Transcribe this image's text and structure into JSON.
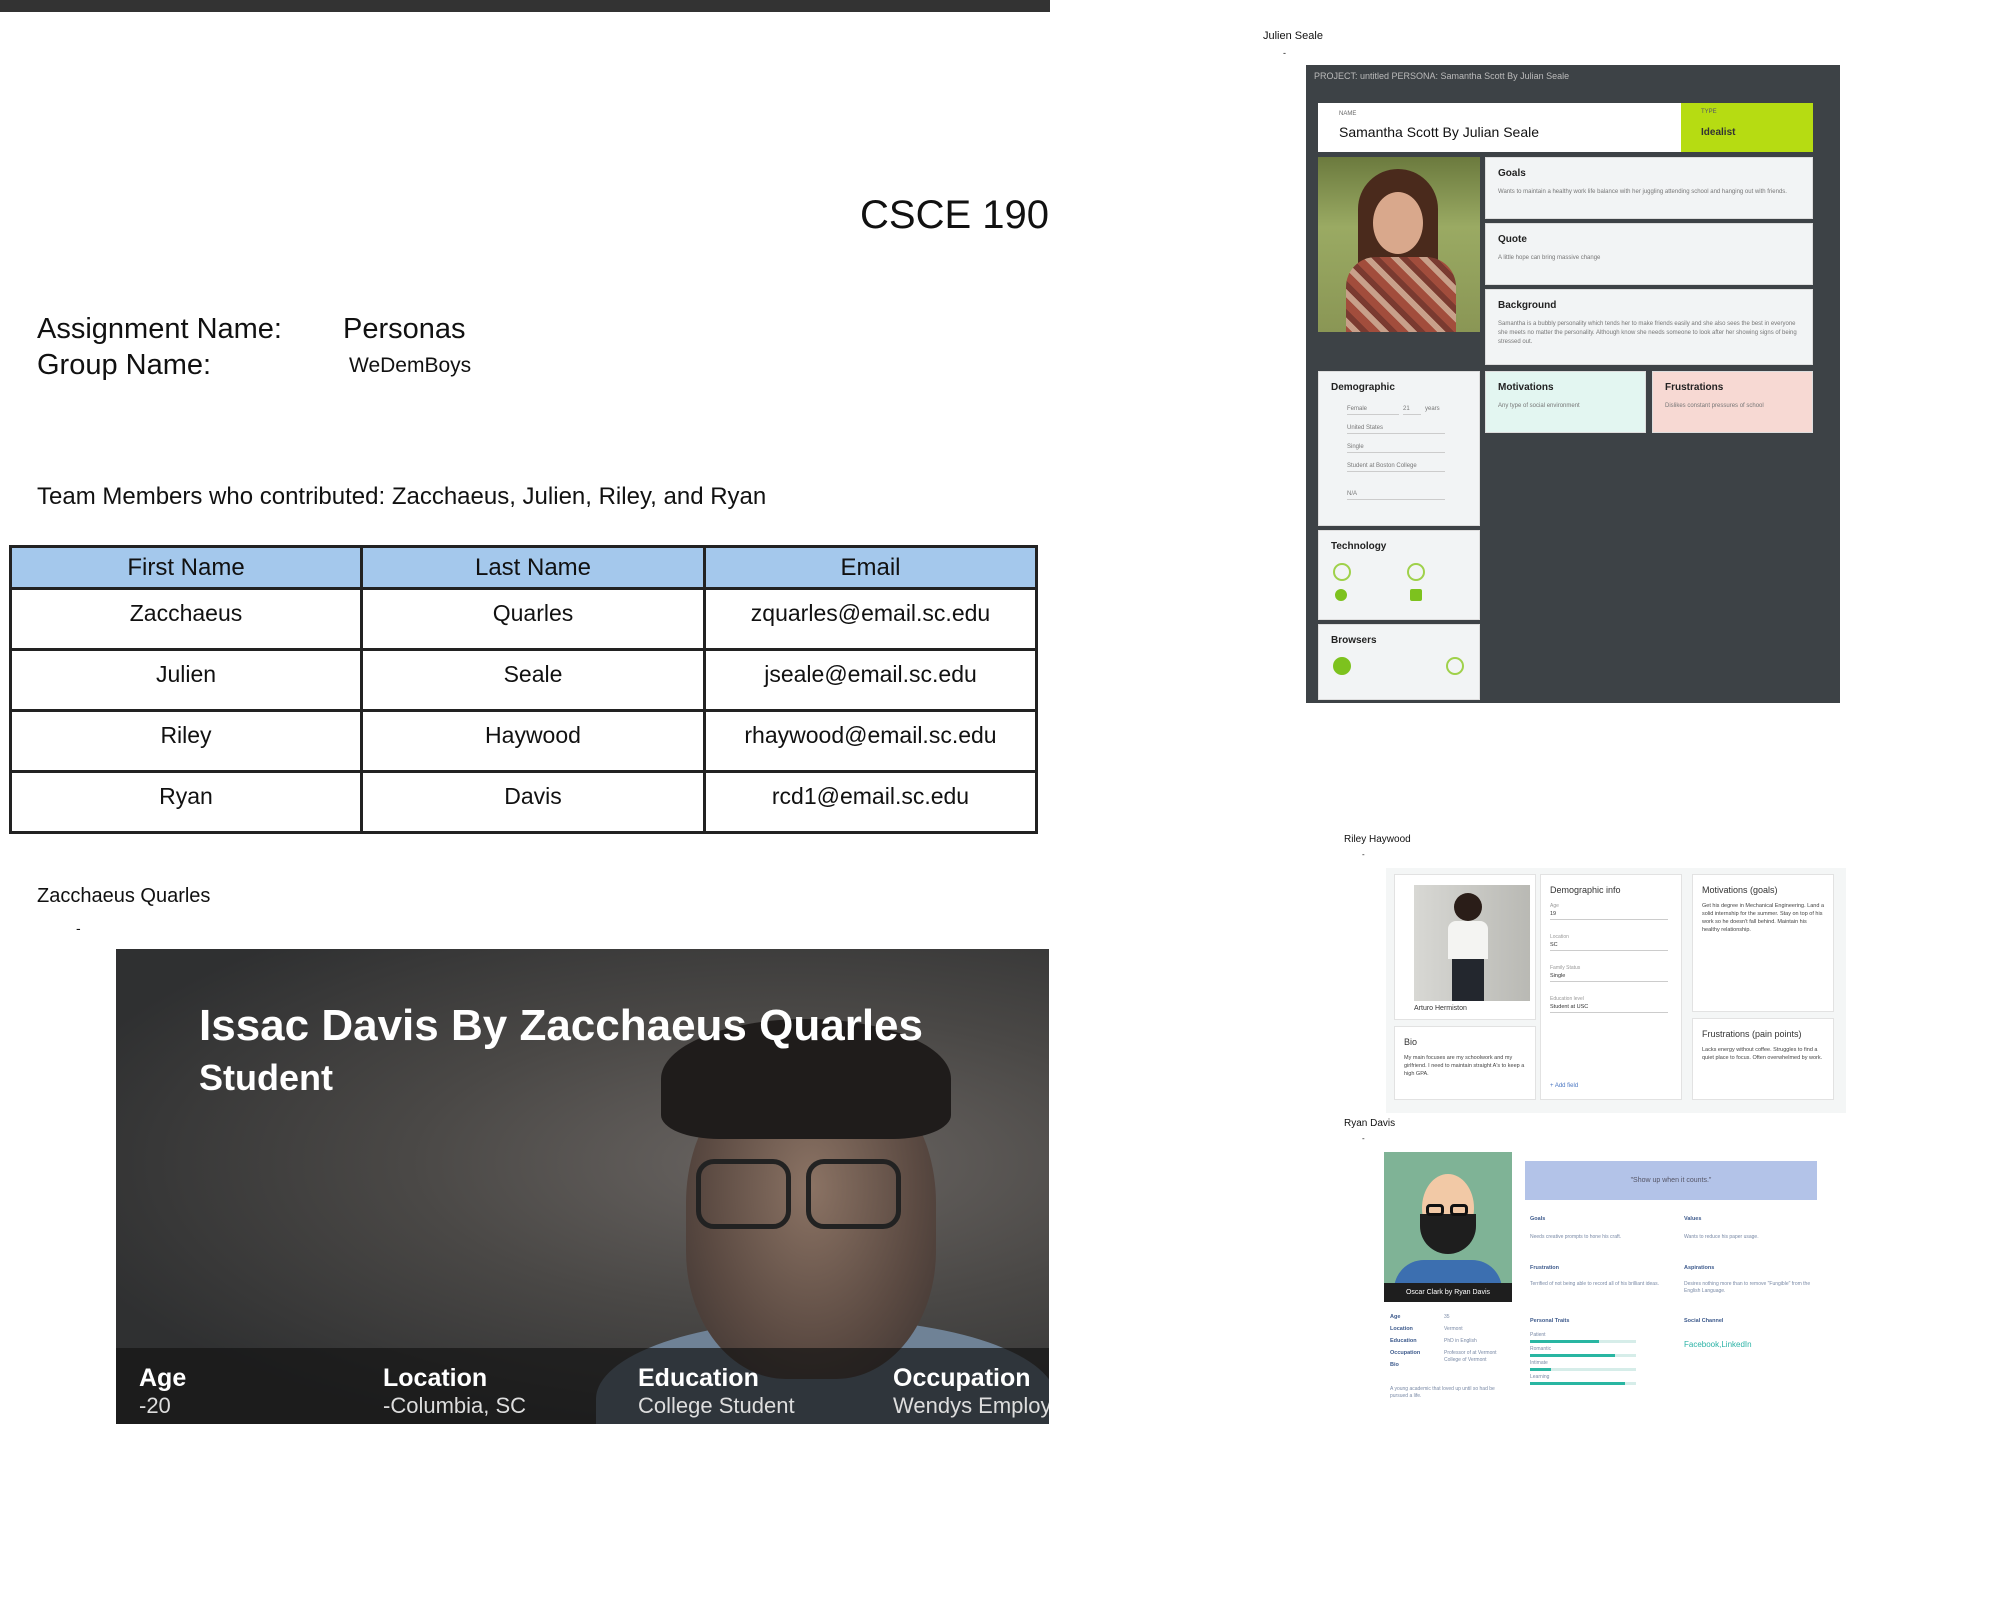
{
  "course": "CSCE 190",
  "assignment": {
    "name_label": "Assignment Name:",
    "name_value": "Personas",
    "group_label": "Group Name:",
    "group_value": "WeDemBoys"
  },
  "team_line": "Team Members who contributed: Zacchaeus, Julien, Riley, and Ryan",
  "table": {
    "headers": [
      "First Name",
      "Last Name",
      "Email"
    ],
    "rows": [
      [
        "Zacchaeus",
        "Quarles",
        "zquarles@email.sc.edu"
      ],
      [
        "Julien",
        "Seale",
        "jseale@email.sc.edu"
      ],
      [
        "Riley",
        "Haywood",
        "rhaywood@email.sc.edu"
      ],
      [
        "Ryan",
        "Davis",
        "rcd1@email.sc.edu"
      ]
    ],
    "header_color": "#a4c8ec"
  },
  "sections": {
    "zacchaeus": "Zacchaeus Quarles",
    "julien": "Julien Seale",
    "riley": "Riley Haywood",
    "ryan": "Ryan Davis",
    "dash": "-"
  },
  "zacchaeus_persona": {
    "title": "Issac Davis By Zacchaeus Quarles",
    "subtitle": "Student",
    "fields": [
      {
        "label": "Age",
        "value": "-20"
      },
      {
        "label": "Location",
        "value": "-Columbia, SC"
      },
      {
        "label": "Education",
        "value": "College Student"
      },
      {
        "label": "Occupation",
        "value": "Wendys Employ"
      }
    ]
  },
  "julien_persona": {
    "topline": "PROJECT: untitled    PERSONA: Samantha Scott By Julian  Seale",
    "name_small": "NAME",
    "name": "Samantha Scott By Julian  Seale",
    "type_small": "TYPE",
    "type": "Idealist",
    "type_color": "#b6dc12",
    "goals_h": "Goals",
    "goals_t": "Wants to maintain a healthy work life balance with her juggling attending school and hanging out with friends.",
    "quote_h": "Quote",
    "quote_t": "A little hope can bring massive change",
    "background_h": "Background",
    "background_t": "Samantha is a bubbly personality which tends her to make friends easily and she also sees the best in everyone she meets no matter the personality. Although know she needs someone to look after her showing signs of being stressed out.",
    "demographic_h": "Demographic",
    "demo": [
      "Female",
      "21",
      "years",
      "United States",
      "Single",
      "Student at Boston College",
      "N/A"
    ],
    "motivations_h": "Motivations",
    "motivations_t": "Any type of social environment",
    "motivations_color": "#e3f6f1",
    "frustrations_h": "Frustrations",
    "frustrations_t": "Dislikes constant pressures of school",
    "frustrations_color": "#f7d9d3",
    "technology_h": "Technology",
    "browsers_h": "Browsers",
    "tech_icons": [
      "phone-icon",
      "laptop-icon",
      "apple-icon",
      "windows-icon"
    ],
    "browser_icons": [
      "chrome-icon",
      "safari-icon"
    ]
  },
  "riley_persona": {
    "photo_caption": "Arturo Hermiston",
    "demo_h": "Demographic info",
    "demo_fields": [
      {
        "k": "Age",
        "v": "19"
      },
      {
        "k": "Location",
        "v": "SC"
      },
      {
        "k": "Family Status",
        "v": "Single"
      },
      {
        "k": "Education level",
        "v": "Student at USC"
      }
    ],
    "add_field": "+ Add field",
    "motivations_h": "Motivations (goals)",
    "motivations_t": "Get his degree in Mechanical Engineering. Land a solid internship for the summer. Stay on top of his work so he doesn't fall behind. Maintain his healthy relationship.",
    "frustrations_h": "Frustrations (pain points)",
    "frustrations_t": "Lacks energy without coffee. Struggles to find a quiet place to focus. Often overwhelmed by work.",
    "bio_h": "Bio",
    "bio_t": "My main focuses are my schoolwork and my girlfriend. I need to maintain straight A's to keep a high GPA."
  },
  "ryan_persona": {
    "caption": "Oscar Clark by Ryan Davis",
    "quote": "\"Show up when it counts.\"",
    "goals_h": "Goals",
    "goals_t": "Needs creative prompts to hone his craft.",
    "values_h": "Values",
    "values_t": "Wants to reduce his paper usage.",
    "frustration_h": "Frustration",
    "frustration_t": "Terrified of not being able to record all of his brilliant ideas.",
    "aspirations_h": "Aspirations",
    "aspirations_t": "Desires nothing more than to remove \"Fungible\" from the English Language.",
    "traits_h": "Personal Traits",
    "traits": [
      {
        "name": "Patient",
        "value": 0.65
      },
      {
        "name": "Romantic",
        "value": 0.8
      },
      {
        "name": "Intimate",
        "value": 0.2
      },
      {
        "name": "Learning",
        "value": 0.9
      }
    ],
    "social_h": "Social Channel",
    "social_t": "Facebook,LinkedIn",
    "info": [
      {
        "k": "Age",
        "v": "35"
      },
      {
        "k": "Location",
        "v": "Vermont"
      },
      {
        "k": "Education",
        "v": "PhD in English"
      },
      {
        "k": "Occupation",
        "v": "Professor of at Vermont College of Vermont"
      },
      {
        "k": "Bio",
        "v": ""
      }
    ],
    "bio_t": "A young academic that loved up until so had be pursued a life."
  }
}
